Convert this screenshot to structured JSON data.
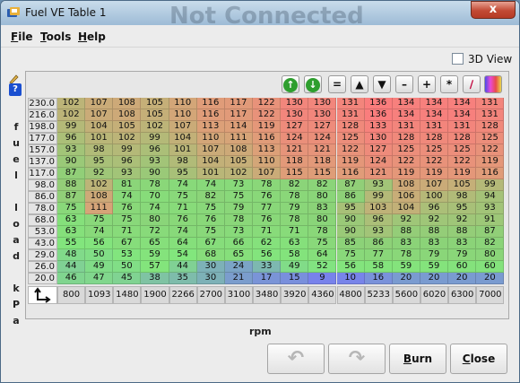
{
  "window": {
    "title": "Fuel VE Table 1",
    "background_text": "Not Connected",
    "close_glyph": "x"
  },
  "menu": [
    {
      "label": "File",
      "mnemonic": "F",
      "rest": "ile"
    },
    {
      "label": "Tools",
      "mnemonic": "T",
      "rest": "ools"
    },
    {
      "label": "Help",
      "mnemonic": "H",
      "rest": "elp"
    }
  ],
  "view3d": {
    "label": "3D View",
    "checked": false
  },
  "help_icon_glyph": "?",
  "vertical_label": [
    "f",
    "u",
    "e",
    "l",
    "",
    "l",
    "o",
    "a",
    "d",
    "",
    "k",
    "P",
    "a"
  ],
  "toolbar": [
    {
      "name": "increase-rounded-icon",
      "glyph": "↑",
      "color": "#2e9e2e"
    },
    {
      "name": "decrease-rounded-icon",
      "glyph": "↓",
      "color": "#2e9e2e"
    },
    {
      "name": "set-equal-button",
      "glyph": "=",
      "color": ""
    },
    {
      "name": "increment-button",
      "glyph": "▲",
      "color": ""
    },
    {
      "name": "decrement-button",
      "glyph": "▼",
      "color": ""
    },
    {
      "name": "subtract-button",
      "glyph": "–",
      "color": ""
    },
    {
      "name": "add-button",
      "glyph": "+",
      "color": ""
    },
    {
      "name": "multiply-button",
      "glyph": "*",
      "color": ""
    },
    {
      "name": "interpolate-icon",
      "glyph": "∕",
      "color": "#c0003a"
    },
    {
      "name": "color-scale-icon",
      "glyph": "",
      "color": ""
    }
  ],
  "table": {
    "y_axis_label": "fuel load kPa",
    "x_axis_label": "rpm",
    "y_bins": [
      "230.0",
      "216.0",
      "198.0",
      "177.0",
      "157.0",
      "137.0",
      "117.0",
      "98.0",
      "86.0",
      "78.0",
      "68.0",
      "53.0",
      "43.0",
      "29.0",
      "26.0",
      "20.0"
    ],
    "x_bins": [
      "800",
      "1093",
      "1480",
      "1900",
      "2266",
      "2700",
      "3100",
      "3480",
      "3920",
      "4360",
      "4800",
      "5233",
      "5600",
      "6020",
      "6300",
      "7000"
    ],
    "rows": [
      [
        102,
        107,
        108,
        105,
        110,
        116,
        117,
        122,
        130,
        130,
        131,
        136,
        134,
        134,
        134,
        131
      ],
      [
        102,
        107,
        108,
        105,
        110,
        116,
        117,
        122,
        130,
        130,
        131,
        136,
        134,
        134,
        134,
        131
      ],
      [
        99,
        104,
        105,
        102,
        107,
        113,
        114,
        119,
        127,
        127,
        128,
        133,
        131,
        131,
        131,
        128
      ],
      [
        96,
        101,
        102,
        99,
        104,
        110,
        111,
        116,
        124,
        124,
        125,
        130,
        128,
        128,
        128,
        125
      ],
      [
        93,
        98,
        99,
        96,
        101,
        107,
        108,
        113,
        121,
        121,
        122,
        127,
        125,
        125,
        125,
        122
      ],
      [
        90,
        95,
        96,
        93,
        98,
        104,
        105,
        110,
        118,
        118,
        119,
        124,
        122,
        122,
        122,
        119
      ],
      [
        87,
        92,
        93,
        90,
        95,
        101,
        102,
        107,
        115,
        115,
        116,
        121,
        119,
        119,
        119,
        116
      ],
      [
        88,
        102,
        81,
        78,
        74,
        74,
        73,
        78,
        82,
        82,
        87,
        93,
        108,
        107,
        105,
        99
      ],
      [
        87,
        108,
        74,
        70,
        75,
        82,
        75,
        76,
        78,
        80,
        86,
        99,
        106,
        100,
        98,
        94
      ],
      [
        75,
        111,
        76,
        74,
        71,
        75,
        79,
        77,
        79,
        83,
        95,
        103,
        104,
        96,
        95,
        93
      ],
      [
        63,
        75,
        75,
        80,
        76,
        76,
        78,
        76,
        78,
        80,
        90,
        96,
        92,
        92,
        92,
        91
      ],
      [
        63,
        74,
        71,
        72,
        74,
        75,
        73,
        71,
        71,
        78,
        90,
        93,
        88,
        88,
        88,
        87
      ],
      [
        55,
        56,
        67,
        65,
        64,
        67,
        66,
        62,
        63,
        75,
        85,
        86,
        83,
        83,
        83,
        82
      ],
      [
        48,
        50,
        53,
        59,
        54,
        68,
        65,
        56,
        58,
        64,
        75,
        77,
        78,
        79,
        79,
        80
      ],
      [
        44,
        49,
        50,
        57,
        44,
        30,
        24,
        33,
        49,
        52,
        56,
        58,
        59,
        59,
        60,
        60
      ],
      [
        46,
        47,
        45,
        38,
        35,
        30,
        21,
        17,
        15,
        9,
        10,
        16,
        20,
        20,
        20,
        20
      ]
    ]
  },
  "buttons": {
    "undo_glyph": "↶",
    "redo_glyph": "↷",
    "burn": {
      "label": "Burn",
      "mnemonic": "B",
      "rest": "urn"
    },
    "close": {
      "label": "Close",
      "mnemonic": "C",
      "rest": "lose"
    }
  }
}
